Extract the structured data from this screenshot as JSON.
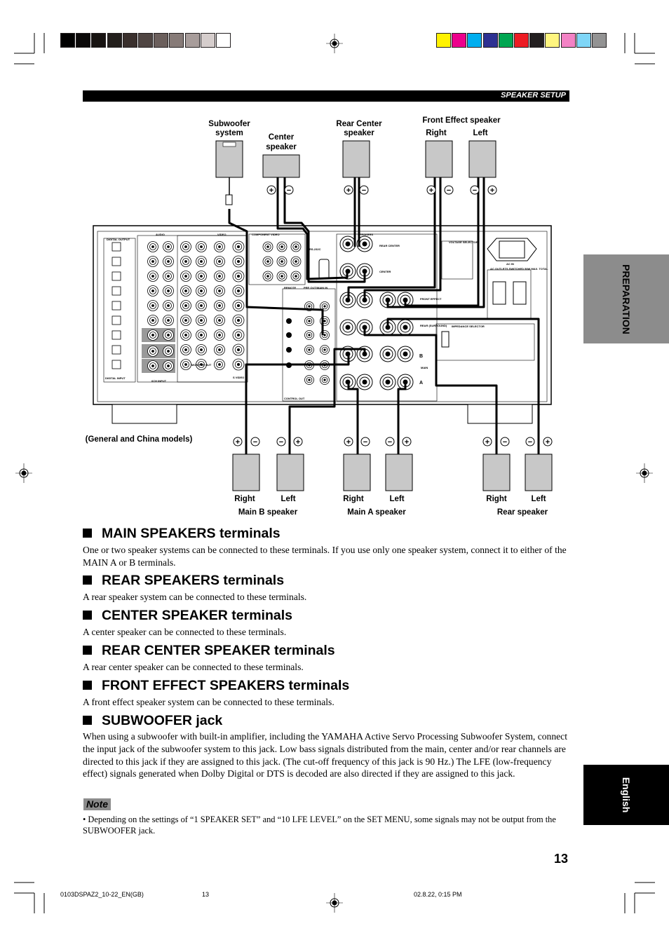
{
  "color_bars": {
    "grayscale": [
      "#000000",
      "#0b0909",
      "#171311",
      "#231f1c",
      "#3a302d",
      "#4f4542",
      "#6b5f5c",
      "#877b78",
      "#a89d9b",
      "#d5cdcc",
      "#ffffff"
    ],
    "process": [
      "#fff200",
      "#ec008c",
      "#00aeef",
      "#2e3192",
      "#00a651",
      "#ed1c24",
      "#231f20",
      "#fff57f",
      "#f382c5",
      "#7fd6f7",
      "#939393"
    ]
  },
  "header": {
    "section": "SPEAKER SETUP"
  },
  "side_tabs": {
    "preparation": "PREPARATION",
    "language": "English"
  },
  "diagram": {
    "top_speakers": {
      "subwoofer": [
        "Subwoofer",
        "system"
      ],
      "center": [
        "Center",
        "speaker"
      ],
      "rear_center": [
        "Rear Center",
        "speaker"
      ],
      "front_effect": "Front Effect speaker",
      "front_effect_right": "Right",
      "front_effect_left": "Left"
    },
    "models_note": "(General and China models)",
    "bottom_speakers": {
      "main_b": {
        "right": "Right",
        "left": "Left",
        "label": "Main B speaker"
      },
      "main_a": {
        "right": "Right",
        "left": "Left",
        "label": "Main A speaker"
      },
      "rear": {
        "right": "Right",
        "left": "Left",
        "label": "Rear speaker"
      }
    },
    "polarity": {
      "plus": "+",
      "minus": "−"
    },
    "panel_labels": {
      "speakers": "SPEAKERS",
      "rear_center": "REAR CENTER",
      "center": "CENTER",
      "front_effect": "FRONT EFFECT",
      "rear": "REAR (SURROUND)",
      "main": "MAIN",
      "a": "A",
      "b": "B",
      "impedance": "IMPEDANCE SELECTOR",
      "voltage": "VOLTAGE SELECTOR",
      "ac_in": "AC IN",
      "ac_outlets": "AC OUTLETS SWITCHED 50W MAX. TOTAL",
      "digital_output": "DIGITAL OUTPUT",
      "digital_input": "DIGITAL INPUT",
      "component_video": "COMPONENT VIDEO",
      "rs232c": "RS-232C",
      "remote": "REMOTE",
      "pre_out": "PRE OUT/MAIN IN",
      "control_out": "CONTROL OUT",
      "six_ch_input": "6CH INPUT",
      "monitor_out": "MONITOR OUT",
      "audio": "AUDIO",
      "video": "VIDEO",
      "s_video": "S VIDEO"
    }
  },
  "sections": [
    {
      "title": "MAIN SPEAKERS terminals",
      "body": "One or two speaker systems can be connected to these terminals. If you use only one speaker system, connect it to either of the MAIN A or B terminals."
    },
    {
      "title": "REAR SPEAKERS terminals",
      "body": "A rear speaker system can be connected to these terminals."
    },
    {
      "title": "CENTER SPEAKER terminals",
      "body": "A center speaker can be connected to these terminals."
    },
    {
      "title": "REAR CENTER SPEAKER terminals",
      "body": "A rear center speaker can be connected to these terminals."
    },
    {
      "title": "FRONT EFFECT SPEAKERS terminals",
      "body": "A front effect speaker system can be connected to these terminals."
    },
    {
      "title": "SUBWOOFER jack",
      "body": "When using a subwoofer with built-in amplifier, including the YAMAHA Active Servo Processing Subwoofer System, connect the input jack of the subwoofer system to this jack. Low bass signals distributed from the main, center and/or rear channels are directed to this jack if they are assigned to this jack. (The cut-off frequency of this jack is 90 Hz.) The LFE (low-frequency effect) signals generated when Dolby Digital or DTS is decoded are also directed if they are assigned to this jack."
    }
  ],
  "note": {
    "label": "Note",
    "text": "• Depending on the settings of “1 SPEAKER SET” and “10 LFE LEVEL” on the SET MENU, some signals may not be output from the SUBWOOFER jack."
  },
  "page_number": "13",
  "footer": {
    "file": "0103DSPAZ2_10-22_EN(GB)",
    "page": "13",
    "date": "02.8.22, 0:15 PM"
  }
}
